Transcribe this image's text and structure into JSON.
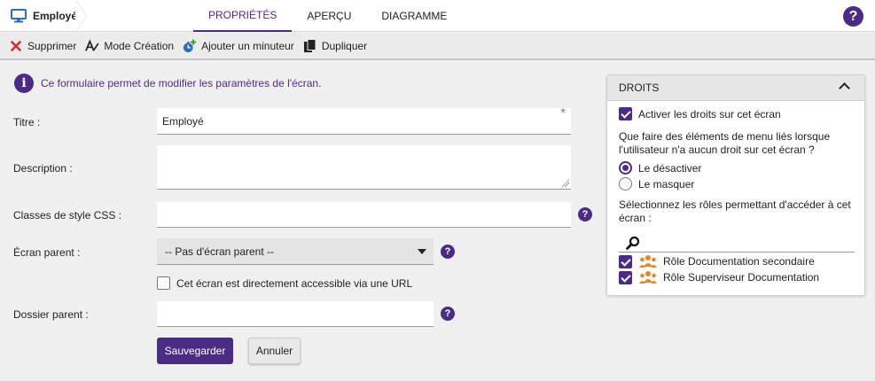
{
  "header": {
    "screen_name": "Employé",
    "tabs": [
      {
        "label": "PROPRIÉTÉS",
        "active": true
      },
      {
        "label": "APERÇU",
        "active": false
      },
      {
        "label": "DIAGRAMME",
        "active": false
      }
    ],
    "help_glyph": "?"
  },
  "toolbar": {
    "items": [
      {
        "label": "Supprimer",
        "icon": "close-icon"
      },
      {
        "label": "Mode Création",
        "icon": "design-mode-icon"
      },
      {
        "label": "Ajouter un minuteur",
        "icon": "timer-add-icon"
      },
      {
        "label": "Dupliquer",
        "icon": "duplicate-icon"
      }
    ]
  },
  "form": {
    "info": "Ce formulaire permet de modifier les paramètres de l'écran.",
    "title_label": "Titre :",
    "title_value": "Employé",
    "required_mark": "*",
    "description_label": "Description :",
    "description_value": "",
    "css_label": "Classes de style CSS :",
    "css_value": "",
    "parent_label": "Écran parent :",
    "parent_selected": "-- Pas d'écran parent --",
    "url_access_label": "Cet écran est directement accessible via une URL",
    "url_access_checked": false,
    "folder_label": "Dossier parent :",
    "folder_value": "",
    "save_label": "Sauvegarder",
    "cancel_label": "Annuler"
  },
  "rights": {
    "title": "DROITS",
    "enable_label": "Activer les droits sur cet écran",
    "enable_checked": true,
    "question": "Que faire des éléments de menu liés lorsque l'utilisateur n'a aucun droit sur cet écran ?",
    "options": [
      {
        "label": "Le désactiver",
        "selected": true
      },
      {
        "label": "Le masquer",
        "selected": false
      }
    ],
    "roles_prompt": "Sélectionnez les rôles permettant d'accéder à cet écran :",
    "search_value": "",
    "roles": [
      {
        "label": "Rôle Documentation secondaire",
        "checked": true
      },
      {
        "label": "Rôle Superviseur Documentation",
        "checked": true
      }
    ]
  },
  "colors": {
    "accent": "#4b2c85",
    "danger": "#d32f2f",
    "role_icon": "#e08a2c"
  }
}
